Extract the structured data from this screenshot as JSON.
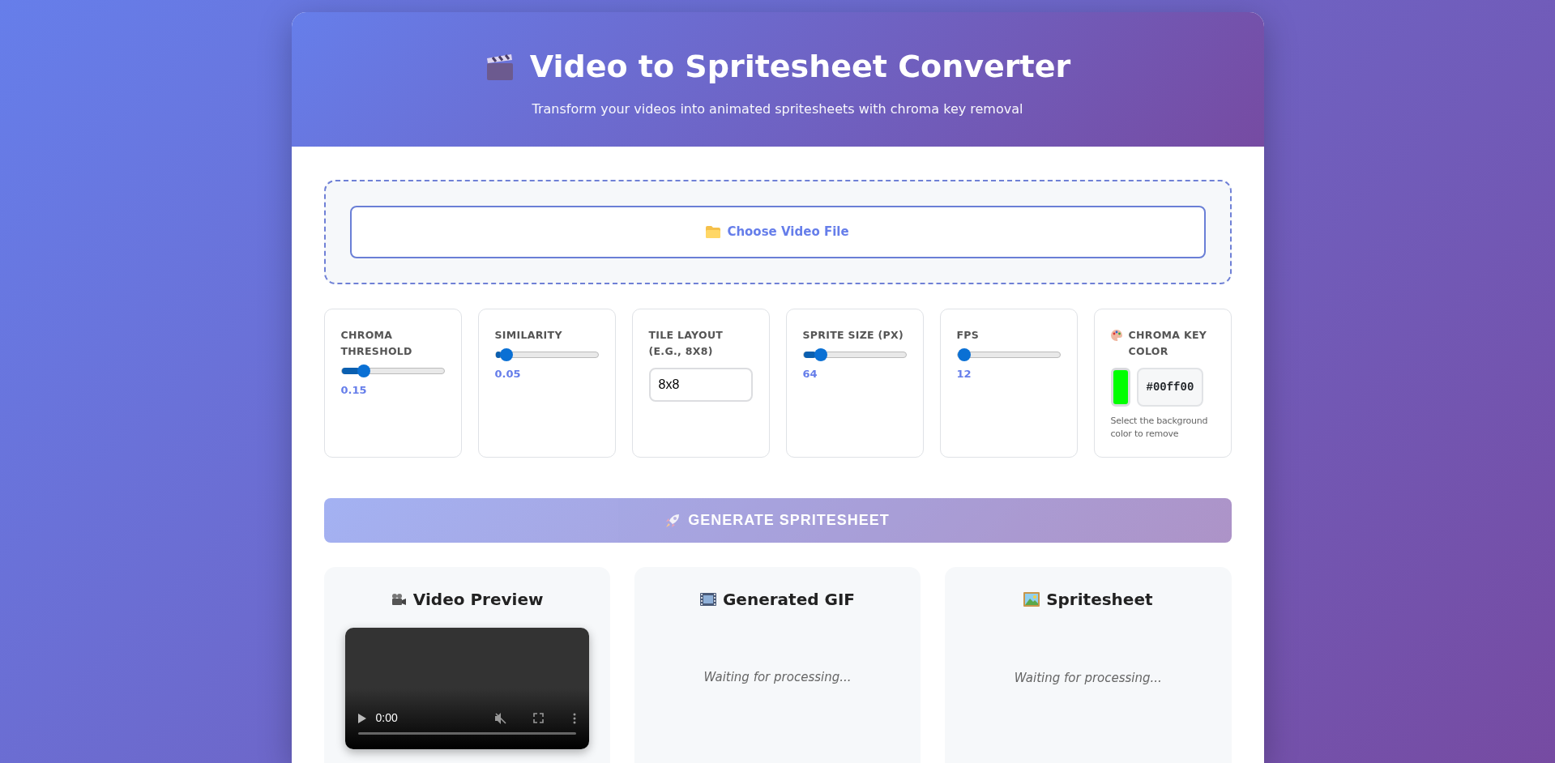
{
  "header": {
    "title": "Video to Spritesheet Converter",
    "subtitle": "Transform your videos into animated spritesheets with chroma key removal"
  },
  "upload": {
    "button": "Choose Video File"
  },
  "settings": [
    {
      "kind": "slider",
      "label": "CHROMA THRESHOLD",
      "level": 0.18,
      "reading": "0.15"
    },
    {
      "kind": "slider",
      "label": "SIMILARITY",
      "level": 0.05,
      "reading": "0.05"
    },
    {
      "kind": "text",
      "label": "TILE LAYOUT (E.G., 8X8)",
      "value": "8x8"
    },
    {
      "kind": "slider",
      "label": "SPRITE SIZE (PX)",
      "level": 0.12,
      "reading": "64"
    },
    {
      "kind": "slider",
      "label": "FPS",
      "level": 0.0,
      "reading": "12"
    },
    {
      "kind": "color",
      "label": "CHROMA KEY COLOR",
      "color": "#00ff00",
      "value": "#00ff00",
      "hint": "Select the background color to remove"
    }
  ],
  "generate_button": {
    "label": "GENERATE SPRITESHEET",
    "disabled": true
  },
  "panels": [
    {
      "kind": "video",
      "title": "Video Preview",
      "time": "0:00"
    },
    {
      "kind": "gif",
      "title": "Generated GIF",
      "status": "Waiting for processing..."
    },
    {
      "kind": "sheet",
      "title": "Spritesheet",
      "status": "Waiting for processing..."
    }
  ]
}
